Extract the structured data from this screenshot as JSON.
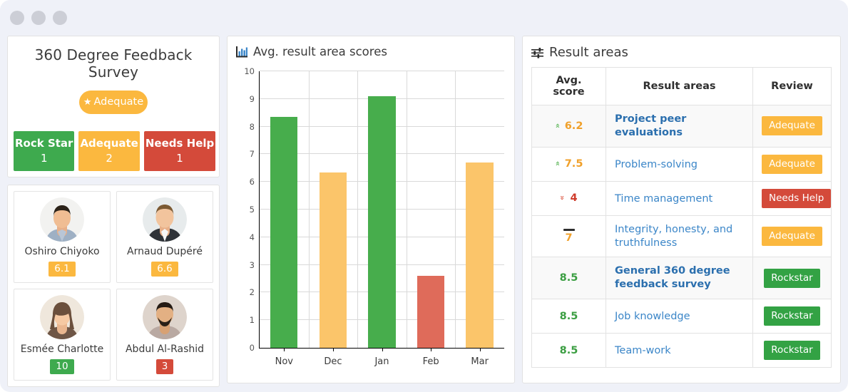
{
  "window": {
    "dots": [
      "dot-1",
      "dot-2",
      "dot-3"
    ]
  },
  "survey": {
    "title": "360 Degree Feedback Survey",
    "overall_rating": "Adequate",
    "overall_icon": "star-icon",
    "score_boxes": [
      {
        "label": "Rock Star",
        "count": "1",
        "color": "#3eaa4e"
      },
      {
        "label": "Adequate",
        "count": "2",
        "color": "#fbb83f"
      },
      {
        "label": "Needs Help",
        "count": "1",
        "color": "#d44a3a"
      }
    ]
  },
  "people": [
    {
      "name": "Oshiro Chiyoko",
      "score": "6.1",
      "level": "orange"
    },
    {
      "name": "Arnaud Dupéré",
      "score": "6.6",
      "level": "orange"
    },
    {
      "name": "Esmée Charlotte",
      "score": "10",
      "level": "green"
    },
    {
      "name": "Abdul Al-Rashid",
      "score": "3",
      "level": "red"
    }
  ],
  "chart_panel": {
    "title": "Avg. result area scores",
    "icon": "bar-chart-icon"
  },
  "chart_data": {
    "type": "bar",
    "title": "Avg. result area scores",
    "categories": [
      "Nov",
      "Dec",
      "Jan",
      "Feb",
      "Mar"
    ],
    "values": [
      8.35,
      6.35,
      9.1,
      2.6,
      6.7
    ],
    "colors": [
      "#47ad4c",
      "#fbc56a",
      "#47ad4c",
      "#df6b5a",
      "#fbc56a"
    ],
    "xlabel": "",
    "ylabel": "",
    "ylim": [
      0,
      10
    ],
    "yticks": [
      0,
      1,
      2,
      3,
      4,
      5,
      6,
      7,
      8,
      9,
      10
    ],
    "grid": true,
    "legend": false
  },
  "result_areas": {
    "title": "Result areas",
    "icon": "sliders-icon",
    "columns": [
      "Avg. score",
      "Result areas",
      "Review"
    ],
    "rows": [
      {
        "score": "6.2",
        "trend": "up",
        "score_color": "orange",
        "area": "Project peer evaluations",
        "review": "Adequate",
        "review_color": "orange",
        "highlight": true
      },
      {
        "score": "7.5",
        "trend": "up",
        "score_color": "orange",
        "area": "Problem-solving",
        "review": "Adequate",
        "review_color": "orange",
        "highlight": false
      },
      {
        "score": "4",
        "trend": "down",
        "score_color": "red",
        "area": "Time management",
        "review": "Needs Help",
        "review_color": "red",
        "highlight": false
      },
      {
        "score": "7",
        "trend": "flat",
        "score_color": "orange",
        "area": "Integrity, honesty, and truthfulness",
        "review": "Adequate",
        "review_color": "orange",
        "highlight": false
      },
      {
        "score": "8.5",
        "trend": "none",
        "score_color": "green",
        "area": "General 360 degree feedback survey",
        "review": "Rockstar",
        "review_color": "green",
        "highlight": true
      },
      {
        "score": "8.5",
        "trend": "none",
        "score_color": "green",
        "area": "Job knowledge",
        "review": "Rockstar",
        "review_color": "green",
        "highlight": false
      },
      {
        "score": "8.5",
        "trend": "none",
        "score_color": "green",
        "area": "Team-work",
        "review": "Rockstar",
        "review_color": "green",
        "highlight": false
      }
    ]
  }
}
